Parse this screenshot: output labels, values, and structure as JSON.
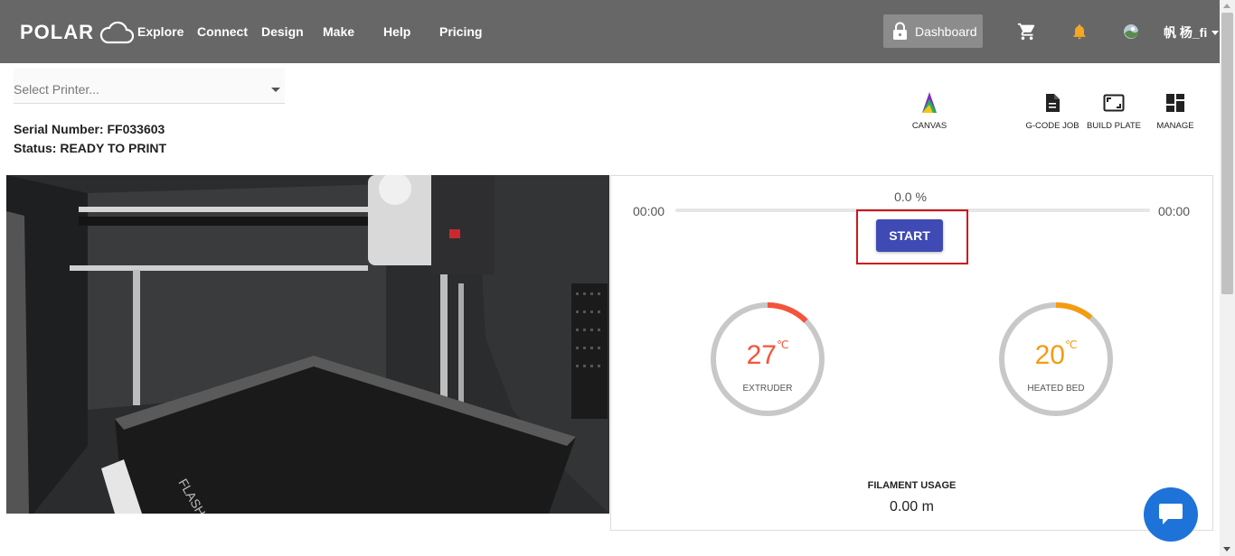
{
  "header": {
    "logo_text": "POLAR",
    "nav": [
      "Explore",
      "Connect",
      "Design",
      "Make",
      "Help",
      "Pricing"
    ],
    "dashboard_label": "Dashboard",
    "user_name": "帆 杨_fi",
    "bell_color": "#f5a623"
  },
  "printer": {
    "select_placeholder": "Select Printer...",
    "serial": "Serial Number: FF033603",
    "status": "Status: READY TO PRINT"
  },
  "tools": [
    {
      "label": "CANVAS",
      "icon": "canvas-icon"
    },
    {
      "label": "G-CODE JOB",
      "icon": "file-icon"
    },
    {
      "label": "BUILD PLATE",
      "icon": "crop-frame-icon"
    },
    {
      "label": "MANAGE",
      "icon": "dashboard-grid-icon"
    }
  ],
  "job": {
    "elapsed": "00:00",
    "remaining": "00:00",
    "percent": "0.0 %",
    "progress_fraction": 0.0,
    "start_label": "START"
  },
  "gauges": {
    "extruder": {
      "value": "27",
      "unit": "℃",
      "label": "EXTRUDER",
      "color": "#f4543a"
    },
    "bed": {
      "value": "20",
      "unit": "℃",
      "label": "HEATED BED",
      "color": "#f39c12"
    }
  },
  "filament": {
    "label": "FILAMENT USAGE",
    "value": "0.00 m"
  },
  "colors": {
    "topbar": "#676767",
    "start_button": "#3f4ab4",
    "highlight": "#d0161c",
    "chat": "#1e73d8"
  }
}
